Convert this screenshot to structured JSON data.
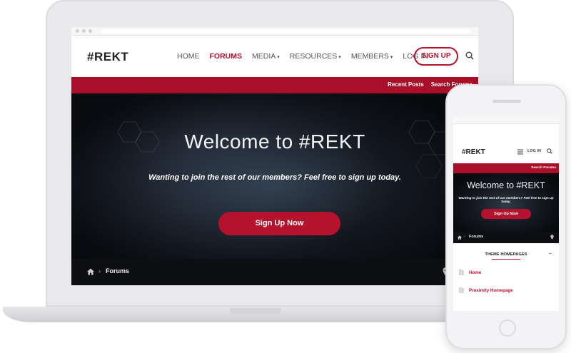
{
  "site": {
    "logo": "#REKT",
    "nav": [
      {
        "label": "HOME",
        "dropdown": false,
        "active": false
      },
      {
        "label": "FORUMS",
        "dropdown": false,
        "active": true
      },
      {
        "label": "MEDIA",
        "dropdown": true,
        "active": false
      },
      {
        "label": "RESOURCES",
        "dropdown": true,
        "active": false
      },
      {
        "label": "MEMBERS",
        "dropdown": true,
        "active": false
      },
      {
        "label": "LOG IN",
        "dropdown": false,
        "active": false
      }
    ],
    "signup_label": "SIGN UP",
    "subnav": {
      "recent_posts": "Recent Posts",
      "search_forums": "Search Forums"
    },
    "hero": {
      "title": "Welcome to #REKT",
      "subtitle": "Wanting to join the rest of our members? Feel free to sign up today.",
      "button": "Sign Up Now"
    },
    "breadcrumb": {
      "current": "Forums"
    }
  },
  "phone": {
    "logo": "#REKT",
    "login": "LOG IN",
    "subnav": {
      "search_forums": "Search Forums"
    },
    "hero": {
      "title": "Welcome to #REKT",
      "subtitle": "Wanting to join the rest of our members? Feel free to sign up today.",
      "button": "Sign Up Now"
    },
    "breadcrumb": {
      "current": "Forums"
    },
    "widget": {
      "title": "THEME HOMEPAGES",
      "items": [
        "Home",
        "Proximity Homepage"
      ]
    }
  },
  "colors": {
    "accent": "#b5122e",
    "red_bar": "#a90f28",
    "hero_bg": "#10141a"
  },
  "icons": {
    "search": "search-icon",
    "home": "home-icon",
    "pin": "map-pin-icon",
    "menu": "menu-icon",
    "doc": "document-icon",
    "collapse": "minus-icon"
  }
}
